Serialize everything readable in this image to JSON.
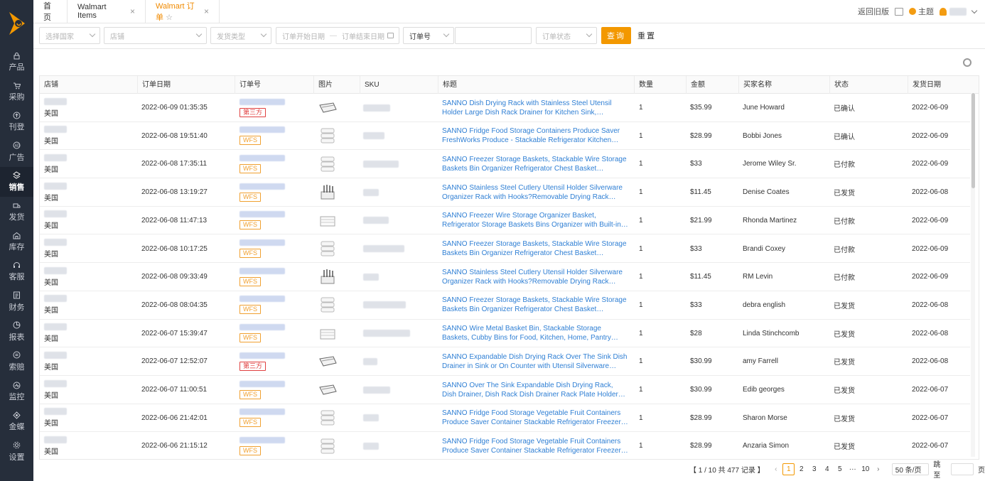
{
  "sidebar": {
    "items": [
      {
        "label": "产品",
        "icon": "lock-icon"
      },
      {
        "label": "采购",
        "icon": "cart-icon"
      },
      {
        "label": "刊登",
        "icon": "upload-icon"
      },
      {
        "label": "广告",
        "icon": "ad-icon"
      },
      {
        "label": "销售",
        "icon": "sales-icon"
      },
      {
        "label": "发货",
        "icon": "truck-icon"
      },
      {
        "label": "库存",
        "icon": "warehouse-icon"
      },
      {
        "label": "客服",
        "icon": "headset-icon"
      },
      {
        "label": "财务",
        "icon": "finance-icon"
      },
      {
        "label": "报表",
        "icon": "chart-icon"
      },
      {
        "label": "索赔",
        "icon": "claim-icon"
      },
      {
        "label": "监控",
        "icon": "monitor-icon"
      },
      {
        "label": "金蝶",
        "icon": "kingdee-icon"
      },
      {
        "label": "设置",
        "icon": "settings-icon"
      }
    ],
    "active_index": 4,
    "brand_color": "#f39800"
  },
  "tabs": {
    "home": "首页",
    "items": "Walmart Items",
    "orders": "Walmart 订单",
    "close": "×",
    "star": "☆"
  },
  "topright": {
    "back": "返回旧版",
    "theme": "主题"
  },
  "filters": {
    "country": "选择国家",
    "store": "店铺",
    "ship_type": "发货类型",
    "start_date": "订单开始日期",
    "end_date": "订单结束日期",
    "order_field": "订单号",
    "status": "订单状态",
    "query": "查询",
    "reset": "重置"
  },
  "table": {
    "headers": [
      "店铺",
      "订单日期",
      "订单号",
      "图片",
      "SKU",
      "标题",
      "数量",
      "金额",
      "买家名称",
      "状态",
      "发货日期"
    ],
    "rows": [
      {
        "country": "美国",
        "date": "2022-06-09 01:35:35",
        "badge": "第三方",
        "badge_type": "third",
        "title": "SANNO Dish Drying Rack with Stainless Steel Utensil Holder Large Dish Rack Drainer for Kitchen Sink, Expandable Dish Rack Shelf ...",
        "qty": "1",
        "amount": "$35.99",
        "buyer": "June Howard",
        "status": "已确认",
        "ship_date": "2022-06-09"
      },
      {
        "country": "美国",
        "date": "2022-06-08 19:51:40",
        "badge": "WFS",
        "badge_type": "wfs",
        "title": "SANNO Fridge Food Storage Containers Produce Saver FreshWorks Produce - Stackable Refrigerator Kitchen Organizer Keeper, Foo...",
        "qty": "1",
        "amount": "$28.99",
        "buyer": "Bobbi Jones",
        "status": "已确认",
        "ship_date": "2022-06-09"
      },
      {
        "country": "美国",
        "date": "2022-06-08 17:35:11",
        "badge": "WFS",
        "badge_type": "wfs",
        "title": "SANNO Freezer Storage Baskets, Stackable Wire Storage Baskets Bin Organizer Refrigerator Chest Basket Organizers Bins for Stora...",
        "qty": "1",
        "amount": "$33",
        "buyer": "Jerome Wiley Sr.",
        "status": "已付款",
        "ship_date": "2022-06-09"
      },
      {
        "country": "美国",
        "date": "2022-06-08 13:19:27",
        "badge": "WFS",
        "badge_type": "wfs",
        "title": "SANNO Stainless Steel Cutlery Utensil Holder Silverware Organizer Rack with Hooks?Removable Drying Rack Silverware Holder Uten...",
        "qty": "1",
        "amount": "$11.45",
        "buyer": "Denise Coates",
        "status": "已发货",
        "ship_date": "2022-06-08"
      },
      {
        "country": "美国",
        "date": "2022-06-08 11:47:13",
        "badge": "WFS",
        "badge_type": "wfs",
        "title": "SANNO Freezer Wire Storage Organizer Basket, Refrigerator Storage Baskets Bins Organizer with Built-in Handles for Cabinets, Pantr...",
        "qty": "1",
        "amount": "$21.99",
        "buyer": "Rhonda Martinez",
        "status": "已付款",
        "ship_date": "2022-06-09"
      },
      {
        "country": "美国",
        "date": "2022-06-08 10:17:25",
        "badge": "WFS",
        "badge_type": "wfs",
        "title": "SANNO Freezer Storage Baskets, Stackable Wire Storage Baskets Bin Organizer Refrigerator Chest Basket Organizers Bins for Stora...",
        "qty": "1",
        "amount": "$33",
        "buyer": "Brandi Coxey",
        "status": "已付款",
        "ship_date": "2022-06-09"
      },
      {
        "country": "美国",
        "date": "2022-06-08 09:33:49",
        "badge": "WFS",
        "badge_type": "wfs",
        "title": "SANNO Stainless Steel Cutlery Utensil Holder Silverware Organizer Rack with Hooks?Removable Drying Rack Silverware Holder Uten...",
        "qty": "1",
        "amount": "$11.45",
        "buyer": "RM Levin",
        "status": "已付款",
        "ship_date": "2022-06-09"
      },
      {
        "country": "美国",
        "date": "2022-06-08 08:04:35",
        "badge": "WFS",
        "badge_type": "wfs",
        "title": "SANNO Freezer Storage Baskets, Stackable Wire Storage Baskets Bin Organizer Refrigerator Chest Basket Organizers Bins for Stora...",
        "qty": "1",
        "amount": "$33",
        "buyer": "debra english",
        "status": "已发货",
        "ship_date": "2022-06-08"
      },
      {
        "country": "美国",
        "date": "2022-06-07 15:39:47",
        "badge": "WFS",
        "badge_type": "wfs",
        "title": "SANNO Wire Metal Basket Bin, Stackable Storage Baskets, Cubby Bins for Food, Kitchen, Home, Pantry Snack, Vegetable, Laundry ...",
        "qty": "1",
        "amount": "$28",
        "buyer": "Linda Stinchcomb",
        "status": "已发货",
        "ship_date": "2022-06-08"
      },
      {
        "country": "美国",
        "date": "2022-06-07 12:52:07",
        "badge": "第三方",
        "badge_type": "third",
        "title": "SANNO Expandable Dish Drying Rack Over The Sink Dish Drainer in Sink or On Counter with Utensil Silverware Storage Holder",
        "qty": "1",
        "amount": "$30.99",
        "buyer": "amy Farrell",
        "status": "已发货",
        "ship_date": "2022-06-08"
      },
      {
        "country": "美国",
        "date": "2022-06-07 11:00:51",
        "badge": "WFS",
        "badge_type": "wfs",
        "title": "SANNO Over The Sink Expandable Dish Drying Rack, Dish Drainer, Dish Rack Dish Drainer Rack Plate Holder Basket in Sink with Ute...",
        "qty": "1",
        "amount": "$30.99",
        "buyer": "Edib georges",
        "status": "已发货",
        "ship_date": "2022-06-07"
      },
      {
        "country": "美国",
        "date": "2022-06-06 21:42:01",
        "badge": "WFS",
        "badge_type": "wfs",
        "title": "SANNO Fridge Food Storage Vegetable Fruit Containers Produce Saver Container Stackable Refrigerator Freezer Organizer Fresh Ke...",
        "qty": "1",
        "amount": "$28.99",
        "buyer": "Sharon Morse",
        "status": "已发货",
        "ship_date": "2022-06-07"
      },
      {
        "country": "美国",
        "date": "2022-06-06 21:15:12",
        "badge": "WFS",
        "badge_type": "wfs",
        "title": "SANNO Fridge Food Storage Vegetable Fruit Containers Produce Saver Container Stackable Refrigerator Freezer Organizer Fresh Ke...",
        "qty": "1",
        "amount": "$28.99",
        "buyer": "Anzaria Simon",
        "status": "已发货",
        "ship_date": "2022-06-07"
      }
    ]
  },
  "pagination": {
    "summary": "【 1 / 10 共 477 记录 】",
    "pages": [
      "1",
      "2",
      "3",
      "4",
      "5",
      "···",
      "10"
    ],
    "current": "1",
    "page_size": "50 条/页",
    "goto": "跳至",
    "suffix": "页",
    "prev": "‹",
    "next": "›"
  }
}
